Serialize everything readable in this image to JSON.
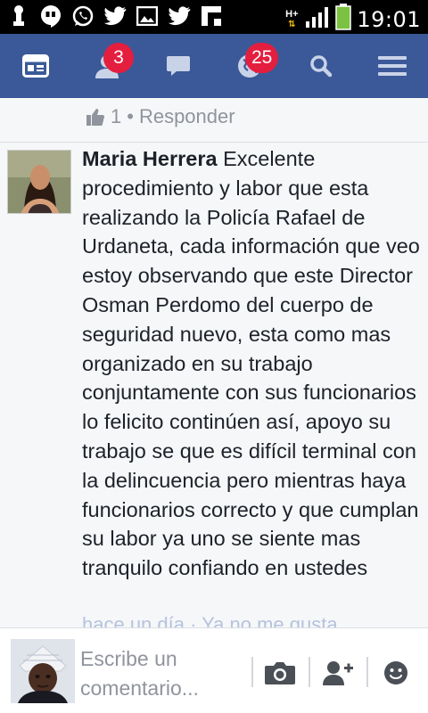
{
  "status_bar": {
    "network": "H+",
    "time": "19:01"
  },
  "nav": {
    "friends_badge": "3",
    "notifications_badge": "25"
  },
  "previous_comment": {
    "likes": "1",
    "reply_label": "Responder"
  },
  "comment": {
    "author": "Maria Herrera",
    "text": "Excelente procedimiento y labor que esta realizando la Policía Rafael de Urdaneta, cada información que veo estoy observando que este Director Osman Perdomo del cuerpo de seguridad nuevo, esta como mas organizado en su trabajo conjuntamente con sus funcionarios lo felicito continúen así, apoyo su trabajo se que es difícil terminal con la delincuencia pero mientras haya funcionarios correcto y que cumplan su labor ya uno se siente mas tranquilo confiando en ustedes",
    "footer_partial": "hace un día · Ya no me gusta"
  },
  "composer": {
    "placeholder": "Escribe un comentario..."
  },
  "colors": {
    "brand_blue": "#3b5998",
    "badge_red": "#e41e3f"
  }
}
